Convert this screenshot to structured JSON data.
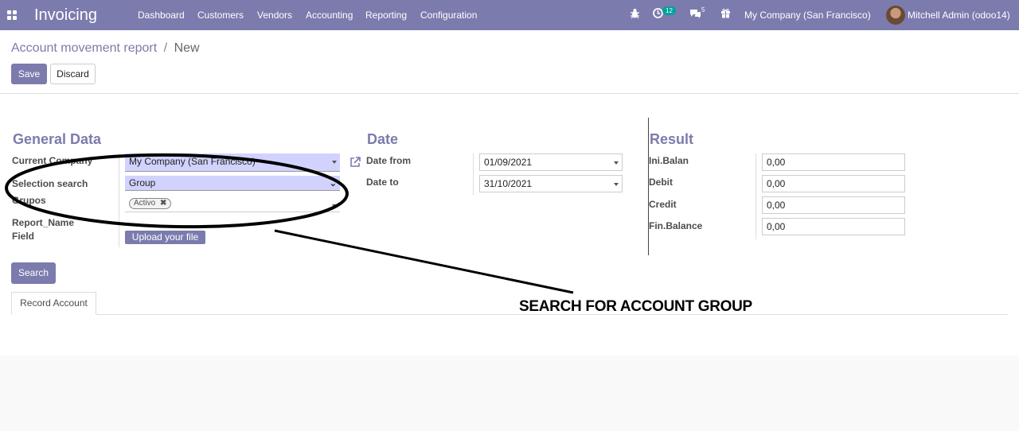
{
  "navbar": {
    "app_title": "Invoicing",
    "menu": [
      "Dashboard",
      "Customers",
      "Vendors",
      "Accounting",
      "Reporting",
      "Configuration"
    ],
    "activity_count": "12",
    "messages_count": "5",
    "company": "My Company (San Francisco)",
    "user": "Mitchell Admin (odoo14)"
  },
  "breadcrumb": {
    "parent": "Account movement report",
    "separator": "/",
    "current": "New"
  },
  "buttons": {
    "save": "Save",
    "discard": "Discard",
    "search": "Search",
    "upload": "Upload your file"
  },
  "general": {
    "title": "General Data",
    "company_label": "Current Company",
    "company_value": "My Company (San Francisco)",
    "selection_label": "Selection search",
    "selection_value": "Group",
    "grupos_label": "Grupos",
    "grupos_tag": "Activo",
    "report_label_1": "Report_Name",
    "report_label_2": "Field"
  },
  "date": {
    "title": "Date",
    "from_label": "Date from",
    "from_value": "01/09/2021",
    "to_label": "Date to",
    "to_value": "31/10/2021"
  },
  "result": {
    "title": "Result",
    "rows": [
      {
        "label": "Ini.Balan",
        "value": "0,00"
      },
      {
        "label": "Debit",
        "value": "0,00"
      },
      {
        "label": "Credit",
        "value": "0,00"
      },
      {
        "label": "Fin.Balance",
        "value": "0,00"
      }
    ]
  },
  "tabs": {
    "record_account": "Record Account"
  },
  "annotation": {
    "text": "SEARCH FOR ACCOUNT GROUP"
  },
  "colors": {
    "brand": "#7c7bad",
    "required_field": "#d2d2ff",
    "badge": "#00a09d"
  }
}
